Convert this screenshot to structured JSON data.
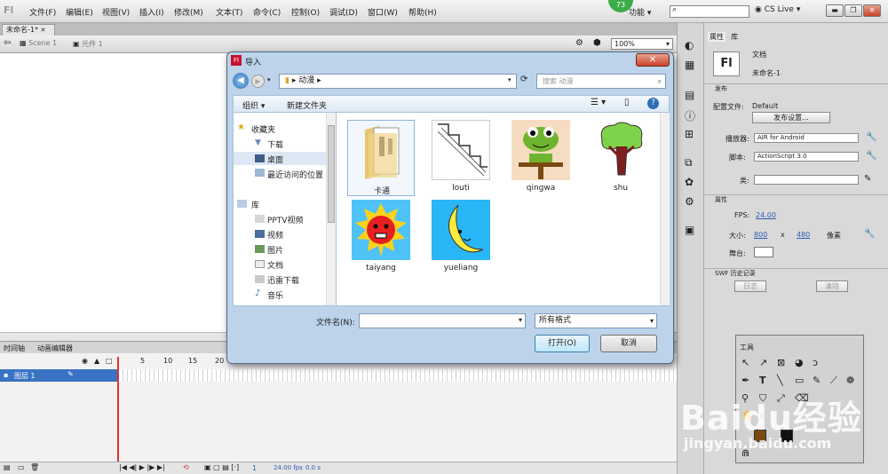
{
  "app": {
    "logo": "Fl"
  },
  "menu": [
    "文件(F)",
    "编辑(E)",
    "视图(V)",
    "插入(I)",
    "修改(M)",
    "文本(T)",
    "命令(C)",
    "控制(O)",
    "调试(D)",
    "窗口(W)",
    "帮助(H)"
  ],
  "status": {
    "badge": "73",
    "workspace": "功能",
    "cslive": "CS Live"
  },
  "doc_tab": "未命名-1*",
  "edit_bar": {
    "scene": "Scene 1",
    "symbol": "元件 1",
    "zoom": "100%"
  },
  "timeline": {
    "tabs": [
      "时间轴",
      "动画编辑器"
    ],
    "layer": "图层 1",
    "ruler": [
      "5",
      "10",
      "15",
      "20"
    ],
    "status": {
      "frame": "1",
      "fps": "24.00 fps",
      "time": "0.0 s"
    }
  },
  "properties": {
    "tabs": [
      "属性",
      "库"
    ],
    "doc_icon": "Fl",
    "doc_type": "文档",
    "doc_name": "未命名-1",
    "publish": {
      "section": "发布",
      "profile_label": "配置文件:",
      "profile_value": "Default",
      "settings_button": "发布设置...",
      "player_label": "播放器:",
      "player_value": "AIR for Android",
      "script_label": "脚本:",
      "script_value": "ActionScript 3.0",
      "class_label": "类:"
    },
    "props": {
      "section": "属性",
      "fps_label": "FPS:",
      "fps_value": "24.00",
      "size_label": "大小:",
      "width": "800",
      "x": "x",
      "height": "480",
      "unit": "像素",
      "stage_label": "舞台:"
    },
    "swf": {
      "section": "SWF 历史记录",
      "log_button": "日志",
      "clear_button": "清除"
    }
  },
  "tools": {
    "title": "工具"
  },
  "dialog": {
    "title": "导入",
    "close": "✕",
    "address": "动漫",
    "search_placeholder": "搜索 动漫",
    "organize": "组织 ▾",
    "new_folder": "新建文件夹",
    "nav": {
      "favorites": "收藏夹",
      "favorite_items": [
        "下载",
        "桌面",
        "最近访问的位置"
      ],
      "libraries": "库",
      "library_items": [
        "PPTV视频",
        "视频",
        "图片",
        "文档",
        "迅雷下载",
        "音乐"
      ]
    },
    "files": [
      {
        "name": "卡通",
        "kind": "folder"
      },
      {
        "name": "louti",
        "kind": "stairs"
      },
      {
        "name": "qingwa",
        "kind": "frog"
      },
      {
        "name": "shu",
        "kind": "tree"
      },
      {
        "name": "taiyang",
        "kind": "sun"
      },
      {
        "name": "yueliang",
        "kind": "moon"
      }
    ],
    "filename_label": "文件名(N):",
    "filename_value": "",
    "filetype": "所有格式",
    "open_button": "打开(O)",
    "cancel_button": "取消"
  },
  "watermark": {
    "brand": "Baidu经验",
    "url": "jingyan.baidu.com"
  },
  "colors": {
    "accent": "#3a73c4",
    "dialog_frame": "#bcd3ea",
    "stage": "#ffffff",
    "playhead": "#e03030",
    "badge": "#3cab4a"
  }
}
